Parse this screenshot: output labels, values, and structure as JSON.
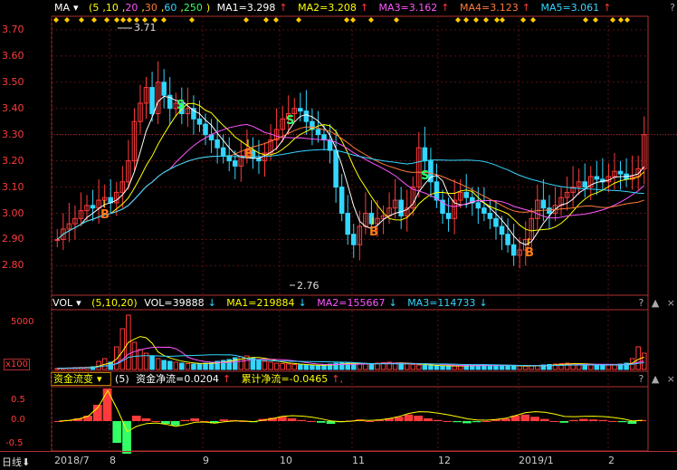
{
  "main": {
    "ma_indicator": {
      "name": "MA",
      "params": [
        "5",
        "10",
        "20",
        "30",
        "60",
        "250"
      ],
      "values": [
        {
          "label": "MA1=3.298",
          "arrow": "↑",
          "color": "#ffffff"
        },
        {
          "label": "MA2=3.208",
          "arrow": "↑",
          "color": "#ffff00"
        },
        {
          "label": "MA3=3.162",
          "arrow": "↑",
          "color": "#ff55ff"
        },
        {
          "label": "MA4=3.123",
          "arrow": "↑",
          "color": "#ff7a3b"
        },
        {
          "label": "MA5=3.061",
          "arrow": "↑",
          "color": "#33d6ff"
        }
      ]
    },
    "y_ticks": [
      "3.70",
      "3.60",
      "3.50",
      "3.40",
      "3.30",
      "3.20",
      "3.10",
      "3.00",
      "2.90",
      "2.80"
    ],
    "high_label": "3.71",
    "low_label": "2.76",
    "signals": [
      {
        "t": "B",
        "x": 111,
        "y": 241
      },
      {
        "t": "S",
        "x": 195,
        "y": 120
      },
      {
        "t": "B",
        "x": 270,
        "y": 174
      },
      {
        "t": "S",
        "x": 316,
        "y": 137
      },
      {
        "t": "B",
        "x": 408,
        "y": 260
      },
      {
        "t": "S",
        "x": 465,
        "y": 198
      },
      {
        "t": "B",
        "x": 580,
        "y": 283
      }
    ]
  },
  "volume": {
    "name": "VOL",
    "params": "(5,10,20)",
    "values": [
      {
        "label": "VOL=39888",
        "arrow": "↓",
        "color": "#ffffff"
      },
      {
        "label": "MA1=219884",
        "arrow": "↓",
        "color": "#ffff00"
      },
      {
        "label": "MA2=155667",
        "arrow": "↓",
        "color": "#ff55ff"
      },
      {
        "label": "MA3=114733",
        "arrow": "↓",
        "color": "#33d6ff"
      }
    ],
    "y_tick": "5000",
    "unit": "x100"
  },
  "fund_flow": {
    "name": "资金流变",
    "param": "(5)",
    "values": [
      {
        "label": "资金净流=0.0204",
        "arrow": "↑",
        "color": "#ffffff"
      },
      {
        "label": "累计净流=-0.0465",
        "arrow": "↑,",
        "color": "#ffff00"
      }
    ],
    "y_ticks": [
      "0.5",
      "0.0",
      "-0.5"
    ]
  },
  "x_axis": {
    "period_label": "日线",
    "labels": [
      "2018/7",
      "8",
      "9",
      "10",
      "11",
      "12",
      "2019/1",
      "2"
    ]
  },
  "controls": {
    "question": "?",
    "up": "▲",
    "close": "×"
  },
  "chart_data": {
    "type": "candlestick",
    "ylim": [
      2.76,
      3.71
    ],
    "x_ticks": [
      "2018/7",
      "8",
      "9",
      "10",
      "11",
      "12",
      "2019/1",
      "2"
    ],
    "y_ticks": [
      2.8,
      2.9,
      3.0,
      3.1,
      3.2,
      3.3,
      3.4,
      3.5,
      3.6,
      3.7
    ],
    "marked_high": 3.71,
    "marked_low": 2.76,
    "ma_last": {
      "MA1": 3.298,
      "MA2": 3.208,
      "MA3": 3.162,
      "MA4": 3.123,
      "MA5": 3.061
    },
    "closes": [
      2.9,
      2.94,
      2.96,
      2.98,
      3.01,
      3.03,
      3.02,
      3.05,
      3.06,
      3.04,
      3.08,
      3.12,
      3.2,
      3.35,
      3.42,
      3.48,
      3.38,
      3.5,
      3.45,
      3.4,
      3.42,
      3.38,
      3.4,
      3.36,
      3.34,
      3.3,
      3.28,
      3.25,
      3.22,
      3.2,
      3.18,
      3.22,
      3.24,
      3.21,
      3.2,
      3.23,
      3.28,
      3.32,
      3.36,
      3.38,
      3.4,
      3.39,
      3.35,
      3.32,
      3.3,
      3.28,
      3.24,
      3.1,
      3.0,
      2.92,
      2.88,
      2.95,
      3.0,
      2.96,
      2.98,
      2.99,
      3.02,
      3.05,
      2.99,
      3.02,
      3.1,
      3.25,
      3.2,
      3.12,
      3.05,
      3.0,
      2.98,
      3.05,
      3.08,
      3.06,
      3.04,
      3.02,
      3.0,
      2.98,
      2.95,
      2.92,
      2.88,
      2.84,
      2.86,
      2.9,
      2.98,
      3.05,
      3.02,
      3.0,
      3.03,
      3.06,
      3.08,
      3.1,
      3.12,
      3.1,
      3.14,
      3.13,
      3.12,
      3.14,
      3.16,
      3.15,
      3.13,
      3.14,
      3.17,
      3.3
    ],
    "volume": [
      120,
      150,
      180,
      210,
      230,
      260,
      300,
      900,
      1200,
      800,
      2500,
      4500,
      6000,
      3000,
      2200,
      1800,
      1500,
      1200,
      1000,
      900,
      800,
      700,
      650,
      600,
      650,
      700,
      800,
      900,
      1000,
      1100,
      1300,
      1400,
      1500,
      1300,
      1100,
      900,
      800,
      700,
      650,
      600,
      550,
      500,
      480,
      450,
      420,
      500,
      600,
      700,
      800,
      700,
      650,
      600,
      620,
      640,
      700,
      750,
      800,
      700,
      650,
      600,
      550,
      500,
      450,
      420,
      400,
      380,
      360,
      400,
      420,
      450,
      480,
      500,
      520,
      480,
      460,
      440,
      420,
      400,
      380,
      360,
      400,
      450,
      500,
      550,
      600,
      650,
      700,
      650,
      600,
      550,
      500,
      480,
      460,
      500,
      550,
      600,
      700,
      1200,
      2500,
      1800
    ],
    "fund_flow": [
      0.0,
      0.02,
      0.05,
      0.1,
      0.3,
      0.6,
      -0.4,
      -0.6,
      0.1,
      0.05,
      0.0,
      -0.05,
      -0.08,
      0.02,
      0.05,
      0.0,
      -0.04,
      0.03,
      0.02,
      0.0,
      -0.02,
      0.04,
      0.06,
      0.08,
      0.05,
      0.02,
      0.0,
      -0.03,
      -0.05,
      -0.02,
      0.01,
      0.03,
      0.0,
      0.02,
      0.05,
      0.08,
      0.12,
      0.1,
      0.05,
      0.02,
      0.0,
      -0.02,
      -0.04,
      -0.02,
      0.0,
      0.03,
      0.05,
      0.1,
      0.12,
      0.08,
      0.04,
      0.0,
      -0.03,
      0.02,
      0.04,
      0.03,
      0.02,
      0.0,
      -0.02,
      -0.05,
      0.02
    ]
  }
}
